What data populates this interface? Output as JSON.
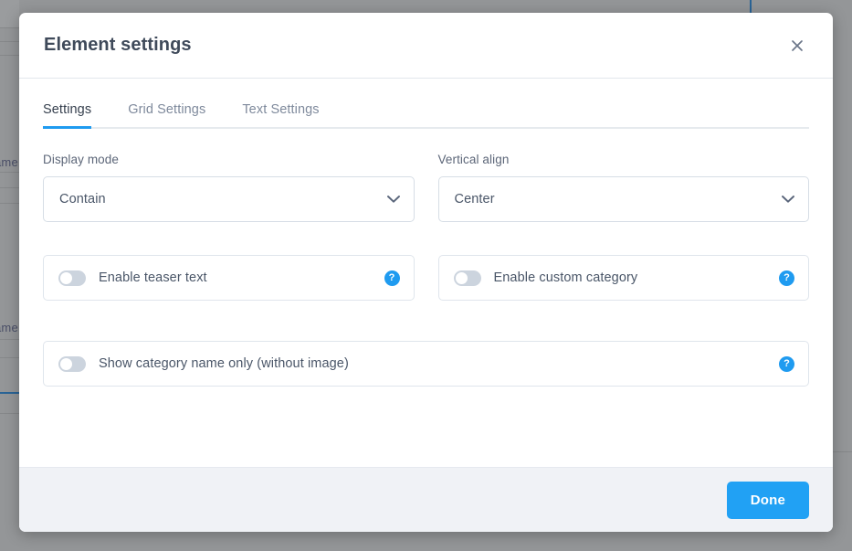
{
  "modal": {
    "title": "Element settings",
    "close_icon": "close-icon",
    "tabs": [
      {
        "label": "Settings",
        "active": true
      },
      {
        "label": "Grid Settings",
        "active": false
      },
      {
        "label": "Text Settings",
        "active": false
      }
    ],
    "fields": [
      {
        "label": "Display mode",
        "value": "Contain",
        "icon": "chevron-down-icon"
      },
      {
        "label": "Vertical align",
        "value": "Center",
        "icon": "chevron-down-icon"
      }
    ],
    "toggles": [
      {
        "label": "Enable teaser text",
        "state": "off",
        "help_icon": "help-icon",
        "help_glyph": "?"
      },
      {
        "label": "Enable custom category",
        "state": "off",
        "help_icon": "help-icon",
        "help_glyph": "?"
      },
      {
        "label": "Show category name only (without image)",
        "state": "off",
        "help_icon": "help-icon",
        "help_glyph": "?"
      }
    ],
    "footer": {
      "done_label": "Done"
    }
  },
  "backdrop": {
    "partial_text_1": "ame",
    "partial_text_2": "ame"
  },
  "colors": {
    "accent": "#1f9bf0",
    "primary_button": "#21a1f4",
    "title_text": "#3f4a5a",
    "label_text": "#5c6678",
    "value_text": "#4a5668",
    "inactive_tab": "#7f8a9c",
    "border": "#d6dde5",
    "footer_bg": "#f0f2f6",
    "switch_off_track": "#ccd4de",
    "overlay": "#949698"
  }
}
